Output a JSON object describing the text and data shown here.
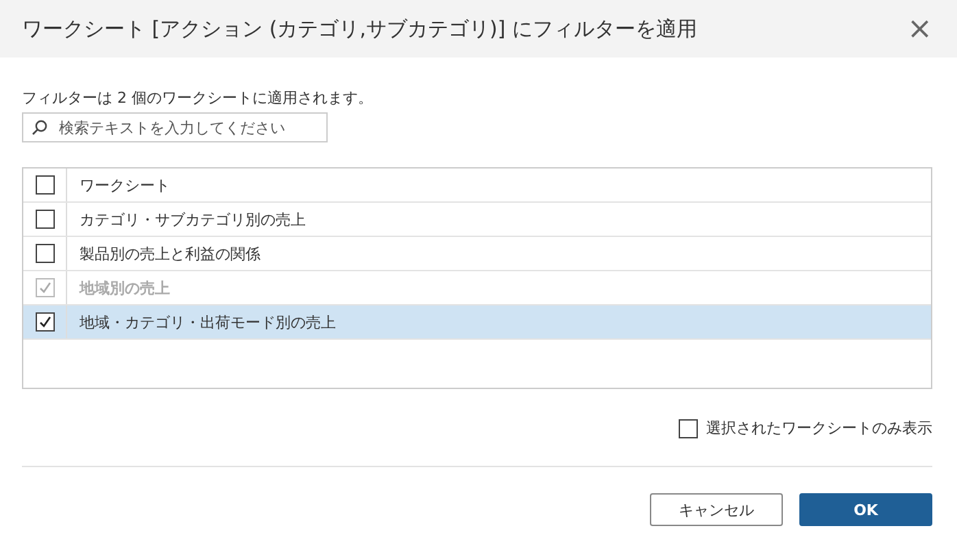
{
  "window": {
    "title": "ワークシート [アクション (カテゴリ,サブカテゴリ)] にフィルターを適用",
    "close": "×"
  },
  "info": "フィルターは 2 個のワークシートに適用されます。",
  "search": {
    "placeholder": "検索テキストを入力してください"
  },
  "table": {
    "header": {
      "label": "ワークシート",
      "checked": false
    },
    "rows": [
      {
        "label": "カテゴリ・サブカテゴリ別の売上",
        "checked": false,
        "disabled": false,
        "selected": false
      },
      {
        "label": "製品別の売上と利益の関係",
        "checked": false,
        "disabled": false,
        "selected": false
      },
      {
        "label": "地域別の売上",
        "checked": true,
        "disabled": true,
        "selected": false
      },
      {
        "label": "地域・カテゴリ・出荷モード別の売上",
        "checked": true,
        "disabled": false,
        "selected": true
      }
    ]
  },
  "show_selected_only": {
    "label": "選択されたワークシートのみ表示",
    "checked": false
  },
  "buttons": [
    {
      "label": "キャンセル",
      "kind": "secondary"
    },
    {
      "label": "OK",
      "kind": "primary"
    }
  ]
}
